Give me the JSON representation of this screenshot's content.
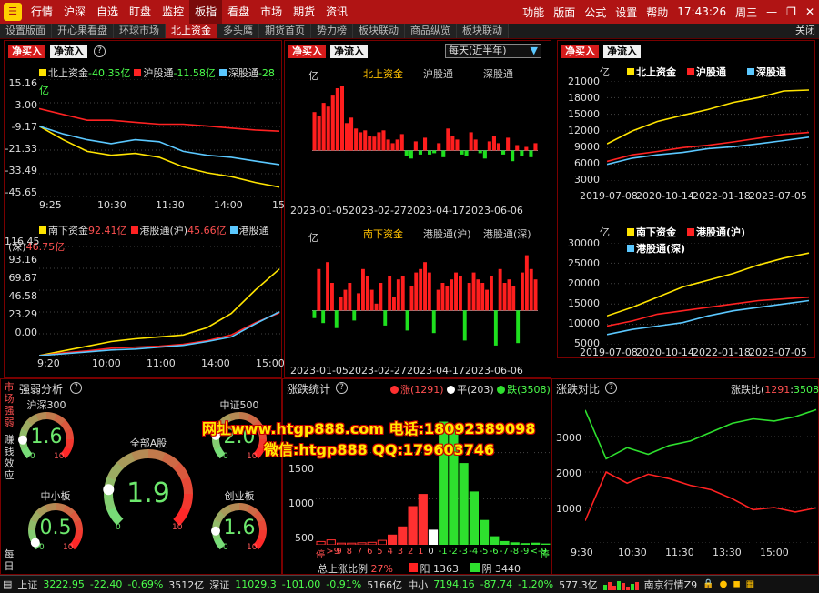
{
  "topbar": {
    "menus": [
      "行情",
      "沪深",
      "自选",
      "盯盘",
      "监控",
      "板指",
      "看盘",
      "市场",
      "期货",
      "资讯"
    ],
    "active": "板指",
    "right": [
      "功能",
      "版面",
      "公式",
      "设置",
      "帮助"
    ],
    "time": "17:43:26",
    "weekday": "周三",
    "winbtns": [
      "—",
      "❐",
      "✕"
    ]
  },
  "tabs": {
    "items": [
      "设置版面",
      "开心果看盘",
      "环球市场",
      "北上资金",
      "多头鹰",
      "期货首页",
      "势力榜",
      "板块联动",
      "商品纵览",
      "板块联动"
    ],
    "active": "北上资金",
    "close": "关闭"
  },
  "btns": {
    "net_buy": "净买入",
    "net_inflow": "净流入",
    "help": "?"
  },
  "left_top": {
    "legend": [
      {
        "label": "北上资金",
        "value": "-40.35亿",
        "color": "#ffe400",
        "vcolor": "#4cff4c"
      },
      {
        "label": "沪股通",
        "value": "-11.58亿",
        "color": "#ff2222",
        "vcolor": "#4cff4c"
      },
      {
        "label": "深股通",
        "value": "-28",
        "color": "#5bc8ff",
        "vcolor": "#4cff4c"
      }
    ],
    "unit": "亿",
    "yticks": [
      "15.16",
      "3.00",
      "-9.17",
      "-21.33",
      "-33.49",
      "-45.65"
    ],
    "xticks": [
      "9:25",
      "10:30",
      "11:30",
      "14:00",
      "15"
    ]
  },
  "left_bot": {
    "legend": [
      {
        "label": "南下资金",
        "value": "92.41亿",
        "color": "#ffe400",
        "vcolor": "#ff5050"
      },
      {
        "label": "港股通(沪)",
        "value": "45.66亿",
        "color": "#ff2222",
        "vcolor": "#ff5050"
      },
      {
        "label": "港股通",
        "value": "",
        "color": "#5bc8ff",
        "vcolor": "#ff5050"
      }
    ],
    "legend2": "(深)",
    "legend2_value": "46.75亿",
    "yticks": [
      "116.45",
      "93.16",
      "69.87",
      "46.58",
      "23.29",
      "0.00"
    ],
    "xticks": [
      "9:20",
      "10:00",
      "11:00",
      "14:00",
      "15:00"
    ]
  },
  "mid": {
    "dropdown": "每天(近半年)",
    "top_headers": [
      "北上资金",
      "沪股通",
      "深股通"
    ],
    "bot_headers": [
      "南下资金",
      "港股通(沪)",
      "港股通(深)"
    ],
    "unit": "亿",
    "xticks": [
      "2023-01-05",
      "2023-02-27",
      "2023-04-17",
      "2023-06-06"
    ]
  },
  "right": {
    "unit": "亿",
    "top_legend": [
      "北上资金",
      "沪股通",
      "深股通"
    ],
    "top_yticks": [
      "21000",
      "18000",
      "15000",
      "12000",
      "9000",
      "6000",
      "3000"
    ],
    "bot_legend": [
      "南下资金",
      "港股通(沪)",
      "港股通(深)"
    ],
    "bot_yticks": [
      "30000",
      "25000",
      "20000",
      "15000",
      "10000",
      "5000"
    ],
    "xticks": [
      "2019-07-08",
      "2020-10-14",
      "2022-01-18",
      "2023-07-05"
    ]
  },
  "strength": {
    "side_labels": [
      "市场强弱",
      "赚钱效应",
      "每日"
    ],
    "title": "强弱分析",
    "gauges": [
      {
        "label": "沪深300",
        "value": "1.6",
        "level": 0.16
      },
      {
        "label": "中证500",
        "value": "2.0",
        "level": 0.2
      },
      {
        "label": "全部A股",
        "value": "1.9",
        "level": 0.19
      },
      {
        "label": "中小板",
        "value": "0.5",
        "level": 0.05
      },
      {
        "label": "创业板",
        "value": "1.6",
        "level": 0.16
      }
    ],
    "gmin": "0",
    "gmax": "10"
  },
  "updown": {
    "title": "涨跌统计",
    "up": "涨(1291)",
    "flat": "平(203)",
    "down": "跌(3508)",
    "xlabels": [
      "停",
      ">9",
      "9",
      "8",
      "7",
      "6",
      "5",
      "4",
      "3",
      "2",
      "1",
      "0",
      "-1",
      "-2",
      "-3",
      "-4",
      "-5",
      "-6",
      "-7",
      "-8",
      "-9",
      "<-9",
      "停"
    ],
    "yticks": [
      "1500",
      "1000",
      "500"
    ],
    "ratio_label": "总上涨比例",
    "ratio_value": "27%",
    "yang_label": "阳",
    "yang_value": "1363",
    "yin_label": "阴",
    "yin_value": "3440"
  },
  "compare": {
    "title": "涨跌对比",
    "ratio_label": "涨跌比(",
    "ratio_up": "1291",
    "ratio_sep": ":",
    "ratio_down": "3508",
    "ratio_close": ")",
    "yticks": [
      "3000",
      "2000",
      "1000"
    ],
    "xticks": [
      "9:30",
      "10:30",
      "11:30",
      "13:30",
      "15:00"
    ]
  },
  "watermark": {
    "line1": "网址www.htgp888.com 电话:18092389098",
    "line2": "微信:htgp888 QQ:179603746"
  },
  "status": {
    "items": [
      {
        "name": "上证",
        "val": "3222.95",
        "chg": "-22.40",
        "pct": "-0.69%",
        "amt": "3512亿"
      },
      {
        "name": "深证",
        "val": "11029.3",
        "chg": "-101.00",
        "pct": "-0.91%",
        "amt": "5166亿"
      },
      {
        "name": "中小",
        "val": "7194.16",
        "chg": "-87.74",
        "pct": "-1.20%",
        "amt": "577.3亿"
      }
    ],
    "server": "南京行情Z9",
    "icons": [
      "lock-icon",
      "bell-icon",
      "chat-icon",
      "keyboard-icon"
    ]
  },
  "chart_data": [
    {
      "type": "line",
      "title": "北上资金",
      "series": [
        {
          "name": "北上资金",
          "values": [
            -9,
            -16,
            -22,
            -24,
            -23,
            -25,
            -30,
            -33,
            -35,
            -38,
            -40.35
          ]
        },
        {
          "name": "沪股通",
          "values": [
            0,
            -3,
            -6,
            -6,
            -7,
            -8,
            -8,
            -9,
            -10,
            -11,
            -11.58
          ]
        },
        {
          "name": "深股通",
          "values": [
            -9,
            -13,
            -16,
            -18,
            -16,
            -17,
            -22,
            -24,
            -25,
            -27,
            -28.77
          ]
        }
      ],
      "ylim": [
        -45.65,
        15.16
      ]
    },
    {
      "type": "line",
      "title": "南下资金",
      "series": [
        {
          "name": "南下资金",
          "values": [
            0,
            5,
            10,
            15,
            18,
            20,
            22,
            30,
            45,
            70,
            92.41
          ]
        },
        {
          "name": "港股通(沪)",
          "values": [
            0,
            3,
            5,
            8,
            9,
            10,
            12,
            16,
            22,
            35,
            45.66
          ]
        },
        {
          "name": "港股通(深)",
          "values": [
            0,
            2,
            4,
            6,
            7,
            9,
            11,
            15,
            20,
            34,
            46.75
          ]
        }
      ],
      "ylim": [
        0,
        116.45
      ]
    },
    {
      "type": "bar",
      "title": "北上资金",
      "values": [
        105,
        95,
        130,
        120,
        150,
        170,
        175,
        75,
        90,
        60,
        50,
        55,
        40,
        38,
        50,
        55,
        30,
        20,
        30,
        45,
        -20,
        -30,
        25,
        -15,
        35,
        -15,
        -10,
        20,
        -25,
        60,
        40,
        30,
        -15,
        -20,
        50,
        30,
        -10,
        -30,
        25,
        40,
        20,
        -15,
        35,
        -40,
        15,
        -20,
        10,
        -25,
        20
      ]
    },
    {
      "type": "bar",
      "title": "南下资金",
      "values": [
        -15,
        60,
        -25,
        70,
        40,
        -35,
        20,
        30,
        40,
        -20,
        25,
        60,
        50,
        30,
        10,
        40,
        -30,
        50,
        20,
        45,
        50,
        -40,
        35,
        55,
        60,
        70,
        55,
        -45,
        30,
        40,
        35,
        45,
        55,
        50,
        -60,
        40,
        55,
        45,
        40,
        30,
        50,
        -70,
        60,
        40,
        45,
        35,
        -65,
        55,
        80,
        60,
        45
      ]
    },
    {
      "type": "line",
      "title": "北上资金累计",
      "series": [
        {
          "name": "北上资金",
          "values": [
            7800,
            10500,
            12500,
            13800,
            15000,
            16500,
            17500,
            18900,
            19100
          ]
        },
        {
          "name": "沪股通",
          "values": [
            4100,
            5500,
            6200,
            7000,
            7500,
            8200,
            9000,
            9800,
            10200
          ]
        },
        {
          "name": "深股通",
          "values": [
            3500,
            4800,
            5500,
            6000,
            6800,
            7200,
            7800,
            8500,
            9200
          ]
        }
      ],
      "ylim": [
        0,
        21000
      ]
    },
    {
      "type": "line",
      "title": "南下资金累计",
      "series": [
        {
          "name": "南下资金",
          "values": [
            8500,
            11000,
            14000,
            17000,
            19000,
            21000,
            23500,
            25500,
            27000
          ]
        },
        {
          "name": "港股通(沪)",
          "values": [
            5500,
            7000,
            9000,
            10000,
            11000,
            12000,
            13000,
            13500,
            14000
          ]
        },
        {
          "name": "港股通(深)",
          "values": [
            3000,
            4500,
            5500,
            6500,
            8500,
            10000,
            11000,
            12000,
            13000
          ]
        }
      ],
      "ylim": [
        0,
        30000
      ]
    },
    {
      "type": "bar",
      "title": "涨跌统计",
      "categories": [
        "停",
        ">9",
        "9",
        "8",
        "7",
        "6",
        "5",
        "4",
        "3",
        "2",
        "1",
        "0",
        "-1",
        "-2",
        "-3",
        "-4",
        "-5",
        "-6",
        "-7",
        "-8",
        "-9",
        "<-9",
        "停"
      ],
      "values": [
        40,
        60,
        20,
        20,
        25,
        30,
        55,
        120,
        220,
        470,
        620,
        180,
        1510,
        1470,
        1000,
        650,
        300,
        100,
        40,
        25,
        15,
        20,
        10
      ],
      "ylim": [
        0,
        1700
      ]
    },
    {
      "type": "line",
      "title": "涨跌对比",
      "series": [
        {
          "name": "涨",
          "values": [
            1000,
            2100,
            1850,
            2050,
            1950,
            1800,
            1700,
            1500,
            1250,
            1300,
            1200,
            1291
          ]
        },
        {
          "name": "跌",
          "values": [
            3500,
            2400,
            2650,
            2500,
            2700,
            2800,
            3000,
            3200,
            3300,
            3250,
            3350,
            3508
          ]
        }
      ],
      "ylim": [
        500,
        3700
      ]
    }
  ]
}
